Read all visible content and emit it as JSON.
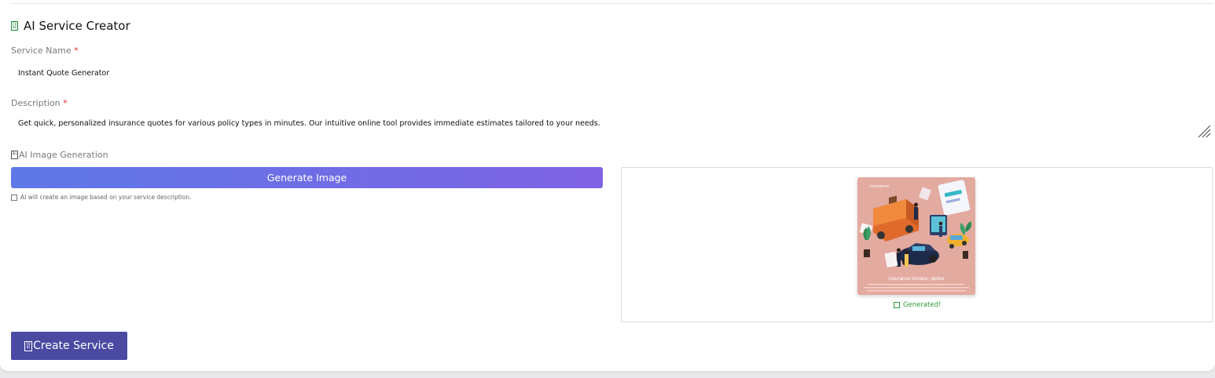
{
  "header": {
    "icon": "form-icon",
    "icon_glyph": "F0 D0",
    "title": "AI Service Creator"
  },
  "service_name": {
    "label": "Service Name",
    "required_marker": "*",
    "value": "Instant Quote Generator"
  },
  "description": {
    "label": "Description",
    "required_marker": "*",
    "value": "Get quick, personalized insurance quotes for various policy types in minutes. Our intuitive online tool provides immediate estimates tailored to your needs."
  },
  "image_generation": {
    "icon": "image-gen-icon",
    "icon_glyph": "鳥a",
    "label": "AI Image Generation",
    "button_label": "Generate Image",
    "hint": "AI will create an image based on your service description.",
    "preview": {
      "image_brand": "Insurance",
      "image_caption": "Iusurance Insrace- quites",
      "status": "Generated!"
    }
  },
  "actions": {
    "create_icon": "create-icon",
    "create_glyph": "F0 B1",
    "create_label": "Create Service"
  },
  "colors": {
    "accent_gradient_start": "#5e78e6",
    "accent_gradient_end": "#7f63e4",
    "create_button": "#4a4aa3",
    "required": "#e03030",
    "success": "#2a9a3c"
  }
}
